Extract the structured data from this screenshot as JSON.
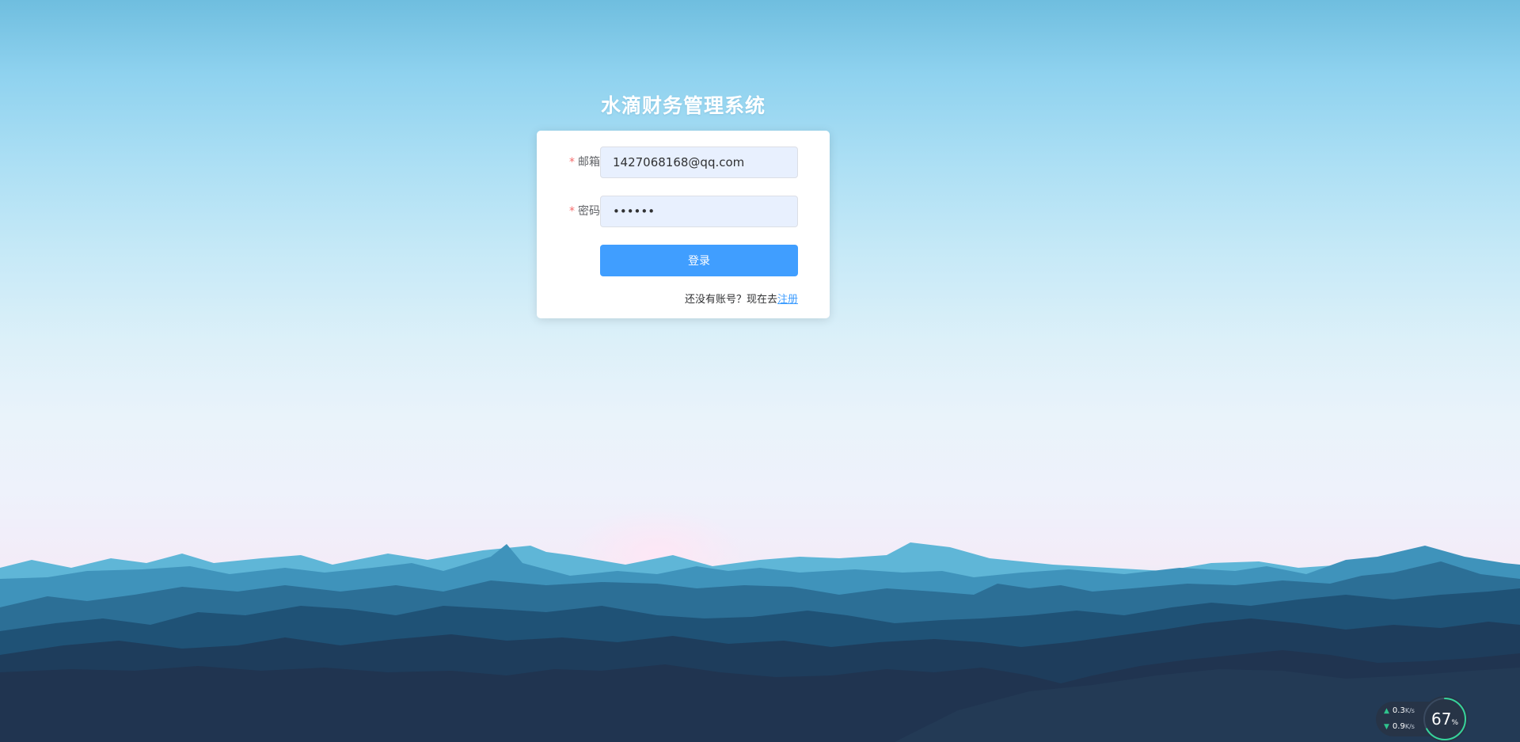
{
  "app": {
    "title": "水滴财务管理系统"
  },
  "form": {
    "email": {
      "required_mark": "*",
      "label": "邮箱",
      "value": "1427068168@qq.com"
    },
    "password": {
      "required_mark": "*",
      "label": "密码",
      "value": "••••••"
    },
    "login_button": "登录",
    "register_prompt": "还没有账号？现在去",
    "register_link": "注册"
  },
  "network_widget": {
    "upload_speed": "0.3",
    "upload_unit": "K/s",
    "download_speed": "0.9",
    "download_unit": "K/s",
    "usage_value": "67",
    "usage_unit": "%",
    "usage_fraction": 0.67
  },
  "colors": {
    "primary": "#409eff",
    "required": "#f56c6c",
    "input_bg": "#e8f0fe"
  }
}
